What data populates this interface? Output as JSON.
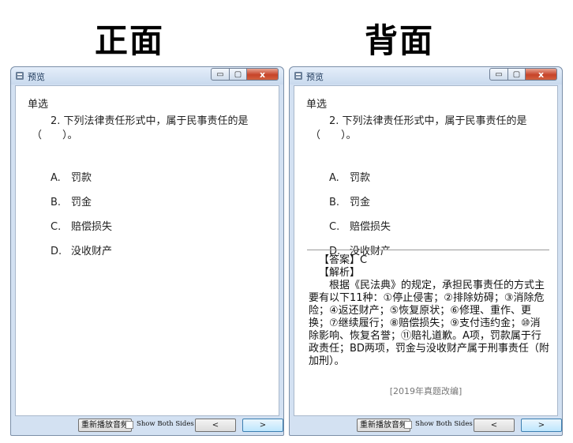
{
  "headings": {
    "front": "正面",
    "back": "背面"
  },
  "window": {
    "title": "预览",
    "title_icon": "app-icon",
    "close_glyph": "x",
    "minimize_glyph": "▭",
    "maximize_glyph": "▢"
  },
  "question": {
    "type": "单选",
    "number": "2.",
    "stem": "下列法律责任形式中，属于民事责任的是（　　）。",
    "options": [
      {
        "letter": "A.",
        "text": "罚款"
      },
      {
        "letter": "B.",
        "text": "罚金"
      },
      {
        "letter": "C.",
        "text": "赔偿损失"
      },
      {
        "letter": "D.",
        "text": "没收财产"
      }
    ]
  },
  "answer": {
    "answer_line": "【答案】C",
    "analysis_label": "【解析】",
    "analysis_text": "根据《民法典》的规定，承担民事责任的方式主要有以下11种：①停止侵害；②排除妨碍；③消除危险；④返还财产；⑤恢复原状；⑥修理、重作、更换；⑦继续履行；⑧赔偿损失；⑨支付违约金；⑩消除影响、恢复名誉；⑪赔礼道歉。A项，罚款属于行政责任；BD两项，罚金与没收财产属于刑事责任（附加刑）。",
    "source": "[2019年真题改编]"
  },
  "bottom_bar": {
    "replay_label": "重新播放音频",
    "show_both_sides_label": "Show Both Sides",
    "show_both_sides_checked": false,
    "prev_label": "<",
    "next_label": ">"
  },
  "colors": {
    "close_button": "#c7442a",
    "next_button_border": "#3c7fb1"
  }
}
